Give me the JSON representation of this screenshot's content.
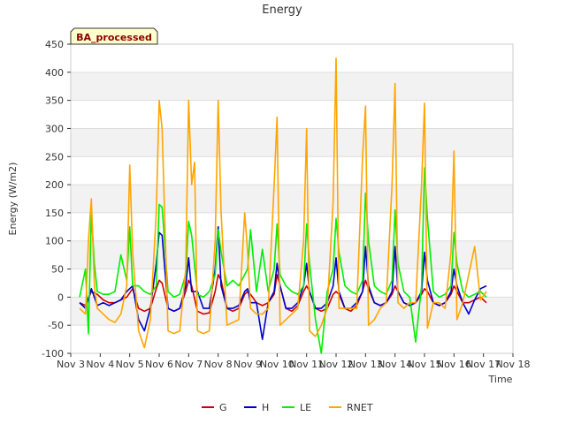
{
  "chart_data": {
    "type": "line",
    "title": "Energy",
    "tag": "BA_processed",
    "xlabel": "Time",
    "ylabel": "Energy (W/m2)",
    "xlim": [
      3,
      18
    ],
    "ylim": [
      -100,
      450
    ],
    "x_ticks": [
      {
        "value": 3,
        "label": "Nov 3"
      },
      {
        "value": 4,
        "label": "Nov 4"
      },
      {
        "value": 5,
        "label": "Nov 5"
      },
      {
        "value": 6,
        "label": "Nov 6"
      },
      {
        "value": 7,
        "label": "Nov 7"
      },
      {
        "value": 8,
        "label": "Nov 8"
      },
      {
        "value": 9,
        "label": "Nov 9"
      },
      {
        "value": 10,
        "label": "Nov 10"
      },
      {
        "value": 11,
        "label": "Nov 11"
      },
      {
        "value": 12,
        "label": "Nov 12"
      },
      {
        "value": 13,
        "label": "Nov 13"
      },
      {
        "value": 14,
        "label": "Nov 14"
      },
      {
        "value": 15,
        "label": "Nov 15"
      },
      {
        "value": 16,
        "label": "Nov 16"
      },
      {
        "value": 17,
        "label": "Nov 17"
      },
      {
        "value": 18,
        "label": "Nov 18"
      }
    ],
    "y_ticks": [
      -100,
      -50,
      0,
      50,
      100,
      150,
      200,
      250,
      300,
      350,
      400,
      450
    ],
    "grid": true,
    "legend_position": "bottom",
    "series": [
      {
        "name": "G",
        "color": "#cc0000",
        "x": [
          3.3,
          3.5,
          3.7,
          3.9,
          4.1,
          4.3,
          4.5,
          4.7,
          4.9,
          5.1,
          5.3,
          5.5,
          5.7,
          5.9,
          6.0,
          6.1,
          6.3,
          6.5,
          6.7,
          6.9,
          7.0,
          7.1,
          7.3,
          7.5,
          7.7,
          7.9,
          8.0,
          8.1,
          8.3,
          8.5,
          8.7,
          8.9,
          9.0,
          9.1,
          9.3,
          9.5,
          9.7,
          9.9,
          10.0,
          10.1,
          10.3,
          10.5,
          10.7,
          10.9,
          11.0,
          11.1,
          11.3,
          11.5,
          11.7,
          11.9,
          12.0,
          12.1,
          12.3,
          12.5,
          12.7,
          12.9,
          13.0,
          13.1,
          13.3,
          13.5,
          13.7,
          13.9,
          14.0,
          14.1,
          14.3,
          14.5,
          14.7,
          14.9,
          15.0,
          15.1,
          15.3,
          15.5,
          15.7,
          15.9,
          16.0,
          16.1,
          16.3,
          16.5,
          16.7,
          16.9,
          17.1
        ],
        "y": [
          -10,
          -15,
          10,
          5,
          -5,
          -10,
          -10,
          -5,
          0,
          15,
          -20,
          -25,
          -20,
          15,
          30,
          25,
          -20,
          -25,
          -20,
          10,
          30,
          20,
          -25,
          -30,
          -28,
          10,
          40,
          30,
          -20,
          -25,
          -20,
          5,
          10,
          5,
          -10,
          -15,
          -10,
          5,
          40,
          20,
          -20,
          -25,
          -15,
          10,
          20,
          10,
          -20,
          -25,
          -20,
          5,
          10,
          5,
          -20,
          -25,
          -15,
          10,
          30,
          15,
          -10,
          -15,
          -10,
          5,
          20,
          10,
          -10,
          -15,
          -10,
          5,
          15,
          10,
          -10,
          -15,
          -10,
          5,
          20,
          10,
          -10,
          -10,
          -5,
          0,
          -10
        ]
      },
      {
        "name": "H",
        "color": "#0000cc",
        "x": [
          3.3,
          3.5,
          3.7,
          3.9,
          4.1,
          4.3,
          4.5,
          4.7,
          4.9,
          5.1,
          5.3,
          5.5,
          5.7,
          5.9,
          6.0,
          6.1,
          6.3,
          6.5,
          6.7,
          6.9,
          7.0,
          7.1,
          7.3,
          7.5,
          7.7,
          7.9,
          8.0,
          8.1,
          8.3,
          8.5,
          8.7,
          8.9,
          9.0,
          9.1,
          9.3,
          9.5,
          9.7,
          9.9,
          10.0,
          10.1,
          10.3,
          10.5,
          10.7,
          10.9,
          11.0,
          11.1,
          11.3,
          11.5,
          11.7,
          11.9,
          12.0,
          12.1,
          12.3,
          12.5,
          12.7,
          12.9,
          13.0,
          13.1,
          13.3,
          13.5,
          13.7,
          13.9,
          14.0,
          14.1,
          14.3,
          14.5,
          14.7,
          14.9,
          15.0,
          15.1,
          15.3,
          15.5,
          15.7,
          15.9,
          16.0,
          16.1,
          16.3,
          16.5,
          16.7,
          16.9,
          17.1
        ],
        "y": [
          -10,
          -20,
          15,
          -15,
          -10,
          -15,
          -10,
          -5,
          10,
          20,
          -40,
          -60,
          -20,
          60,
          115,
          110,
          -20,
          -25,
          -20,
          20,
          70,
          10,
          10,
          -20,
          -20,
          50,
          125,
          20,
          -20,
          -20,
          -15,
          10,
          15,
          -10,
          -10,
          -75,
          -10,
          10,
          60,
          20,
          -20,
          -20,
          -10,
          20,
          60,
          10,
          -20,
          -20,
          -10,
          20,
          70,
          10,
          -20,
          -20,
          -10,
          10,
          90,
          20,
          -10,
          -15,
          -10,
          10,
          90,
          10,
          -10,
          -15,
          -10,
          10,
          80,
          30,
          -10,
          -15,
          -10,
          10,
          50,
          20,
          -10,
          -30,
          -5,
          15,
          20
        ]
      },
      {
        "name": "LE",
        "color": "#00ee00",
        "x": [
          3.3,
          3.5,
          3.6,
          3.7,
          3.8,
          3.9,
          4.1,
          4.3,
          4.5,
          4.7,
          4.9,
          5.0,
          5.1,
          5.3,
          5.5,
          5.7,
          5.9,
          6.0,
          6.1,
          6.3,
          6.5,
          6.7,
          6.9,
          7.0,
          7.1,
          7.3,
          7.5,
          7.7,
          7.9,
          8.0,
          8.1,
          8.3,
          8.5,
          8.7,
          8.9,
          9.0,
          9.1,
          9.3,
          9.5,
          9.7,
          9.9,
          10.0,
          10.1,
          10.3,
          10.5,
          10.7,
          10.9,
          11.0,
          11.1,
          11.3,
          11.5,
          11.7,
          11.9,
          12.0,
          12.1,
          12.3,
          12.5,
          12.7,
          12.9,
          13.0,
          13.1,
          13.3,
          13.5,
          13.7,
          13.9,
          14.0,
          14.1,
          14.3,
          14.5,
          14.7,
          14.9,
          15.0,
          15.1,
          15.3,
          15.5,
          15.7,
          15.9,
          16.0,
          16.1,
          16.3,
          16.5,
          16.7,
          16.9,
          17.1
        ],
        "y": [
          0,
          50,
          -65,
          150,
          60,
          10,
          5,
          5,
          10,
          75,
          30,
          125,
          20,
          20,
          10,
          5,
          20,
          165,
          160,
          10,
          0,
          5,
          40,
          135,
          110,
          5,
          0,
          10,
          40,
          120,
          80,
          20,
          30,
          20,
          40,
          50,
          120,
          10,
          85,
          10,
          50,
          130,
          40,
          20,
          10,
          5,
          20,
          130,
          60,
          -40,
          -100,
          10,
          50,
          140,
          80,
          20,
          10,
          5,
          30,
          185,
          100,
          20,
          10,
          5,
          30,
          155,
          60,
          10,
          0,
          -80,
          20,
          230,
          140,
          10,
          0,
          5,
          20,
          115,
          60,
          10,
          0,
          5,
          10,
          0
        ]
      },
      {
        "name": "RNET",
        "color": "#ffa500",
        "x": [
          3.3,
          3.5,
          3.6,
          3.7,
          3.8,
          3.9,
          4.1,
          4.3,
          4.5,
          4.7,
          4.9,
          5.0,
          5.1,
          5.3,
          5.5,
          5.7,
          5.9,
          6.0,
          6.1,
          6.3,
          6.5,
          6.7,
          6.9,
          7.0,
          7.1,
          7.2,
          7.3,
          7.5,
          7.7,
          7.9,
          8.0,
          8.1,
          8.3,
          8.5,
          8.7,
          8.9,
          9.0,
          9.1,
          9.3,
          9.5,
          9.7,
          9.9,
          10.0,
          10.1,
          10.3,
          10.5,
          10.7,
          10.9,
          11.0,
          11.1,
          11.3,
          11.5,
          11.7,
          11.9,
          12.0,
          12.1,
          12.3,
          12.5,
          12.7,
          12.9,
          13.0,
          13.1,
          13.3,
          13.5,
          13.7,
          13.9,
          14.0,
          14.1,
          14.3,
          14.5,
          14.7,
          14.9,
          15.0,
          15.1,
          15.3,
          15.5,
          15.7,
          15.9,
          16.0,
          16.1,
          16.3,
          16.5,
          16.7,
          16.9,
          17.1
        ],
        "y": [
          -20,
          -30,
          100,
          175,
          20,
          -20,
          -30,
          -40,
          -45,
          -30,
          20,
          235,
          80,
          -60,
          -90,
          -40,
          150,
          350,
          300,
          -60,
          -65,
          -60,
          50,
          350,
          200,
          240,
          -60,
          -65,
          -60,
          100,
          350,
          150,
          -50,
          -45,
          -40,
          150,
          80,
          -20,
          -30,
          -30,
          -20,
          200,
          320,
          -50,
          -40,
          -30,
          -20,
          100,
          300,
          -60,
          -70,
          -50,
          -20,
          170,
          425,
          -20,
          -20,
          -20,
          -20,
          250,
          340,
          -50,
          -40,
          -20,
          -10,
          200,
          380,
          -10,
          -20,
          -10,
          -10,
          200,
          345,
          -55,
          -10,
          -10,
          -20,
          80,
          260,
          -40,
          -10,
          40,
          90,
          -5,
          10
        ]
      }
    ]
  }
}
